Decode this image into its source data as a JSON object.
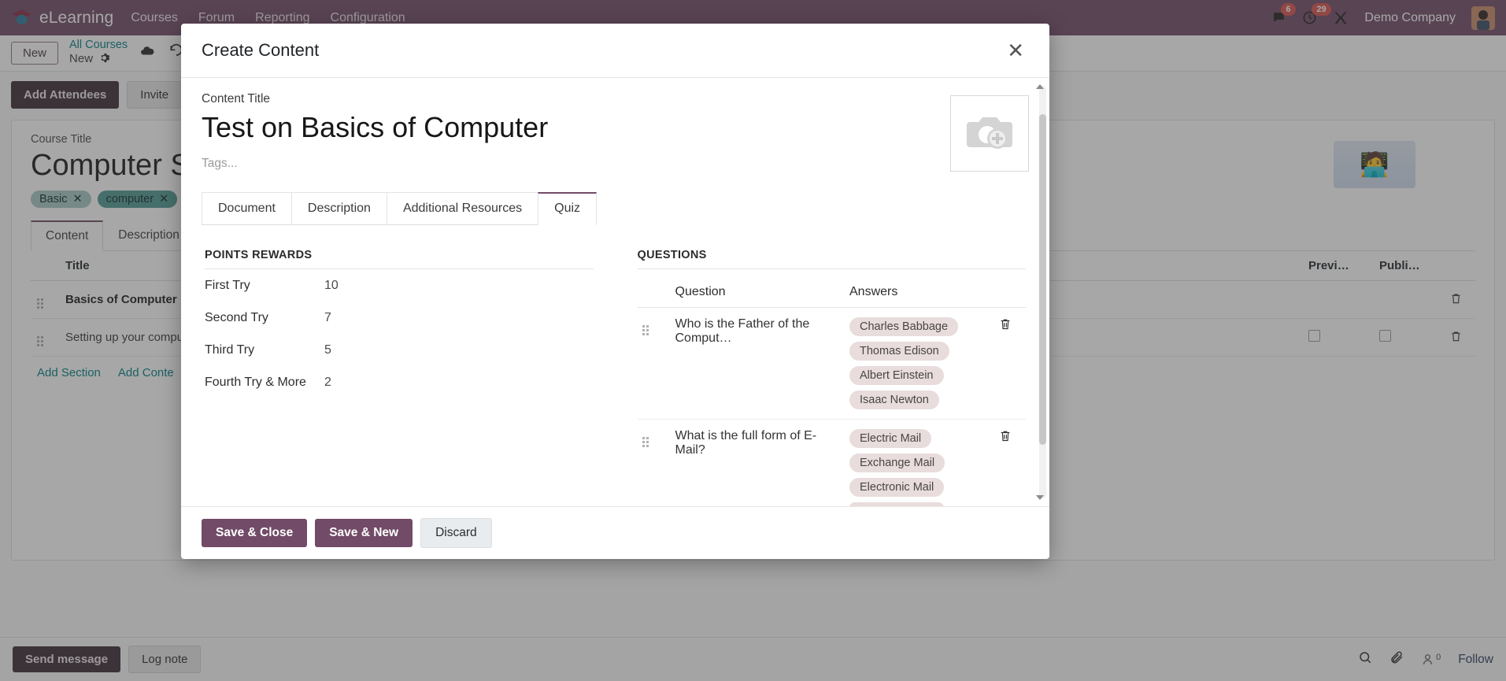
{
  "navbar": {
    "brand": "eLearning",
    "links": [
      "Courses",
      "Forum",
      "Reporting",
      "Configuration"
    ],
    "messages_badge": "6",
    "activities_badge": "29",
    "company": "Demo Company"
  },
  "control_panel": {
    "new_button": "New",
    "breadcrumb_root": "All Courses",
    "breadcrumb_current": "New"
  },
  "background": {
    "add_attendees": "Add Attendees",
    "invite": "Invite",
    "course_title_label": "Course Title",
    "course_title_value": "Computer S",
    "tags": [
      {
        "label": "Basic",
        "remove": "✕"
      },
      {
        "label": "computer",
        "remove": "✕"
      }
    ],
    "tabs": [
      "Content",
      "Description"
    ],
    "table": {
      "headers": [
        "Title",
        "Previ…",
        "Publi…"
      ],
      "rows": [
        {
          "title": "Basics of Computer",
          "bold": true,
          "has_checkboxes": false
        },
        {
          "title": "Setting up your compute",
          "bold": false,
          "has_checkboxes": true
        }
      ]
    },
    "add_section": "Add Section",
    "add_content": "Add Conte",
    "send_message": "Send message",
    "log_note": "Log note",
    "follower_count": "0",
    "follow": "Follow"
  },
  "modal": {
    "title": "Create Content",
    "close_label": "✕",
    "content_title_label": "Content Title",
    "content_title_value": "Test on Basics of Computer",
    "tags_placeholder": "Tags...",
    "tabs": [
      {
        "label": "Document",
        "active": false
      },
      {
        "label": "Description",
        "active": false
      },
      {
        "label": "Additional Resources",
        "active": false
      },
      {
        "label": "Quiz",
        "active": true
      }
    ],
    "points_rewards": {
      "section_title": "POINTS REWARDS",
      "rows": [
        {
          "label": "First Try",
          "value": "10"
        },
        {
          "label": "Second Try",
          "value": "7"
        },
        {
          "label": "Third Try",
          "value": "5"
        },
        {
          "label": "Fourth Try & More",
          "value": "2"
        }
      ]
    },
    "questions": {
      "section_title": "QUESTIONS",
      "col_question": "Question",
      "col_answers": "Answers",
      "rows": [
        {
          "question": "Who is the Father of the Comput…",
          "answers": [
            "Charles Babbage",
            "Thomas Edison",
            "Albert Einstein",
            "Isaac Newton"
          ]
        },
        {
          "question": "What is the full form of E-Mail?",
          "answers": [
            "Electric Mail",
            "Exchange Mail",
            "Electronic Mail",
            ""
          ]
        }
      ]
    },
    "footer": {
      "save_close": "Save & Close",
      "save_new": "Save & New",
      "discard": "Discard"
    }
  }
}
